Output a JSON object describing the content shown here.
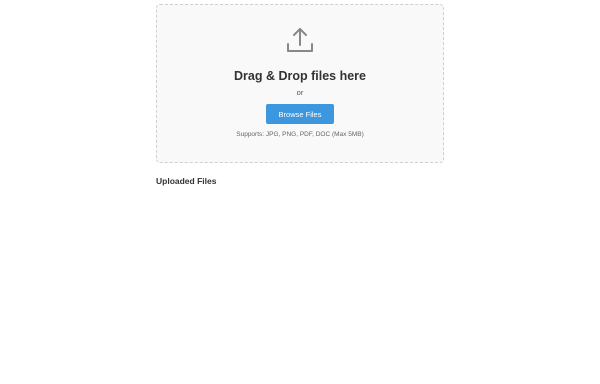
{
  "dropzone": {
    "icon": "upload-icon",
    "title": "Drag & Drop files here",
    "or_text": "or",
    "browse_label": "Browse Files",
    "supports_text": "Supports: JPG, PNG, PDF, DOC (Max 5MB)"
  },
  "uploaded": {
    "title": "Uploaded Files"
  },
  "colors": {
    "accent": "#3d97de",
    "dropzone_bg": "#f9f9f9",
    "dropzone_border": "#cfcfcf",
    "icon": "#888888"
  }
}
